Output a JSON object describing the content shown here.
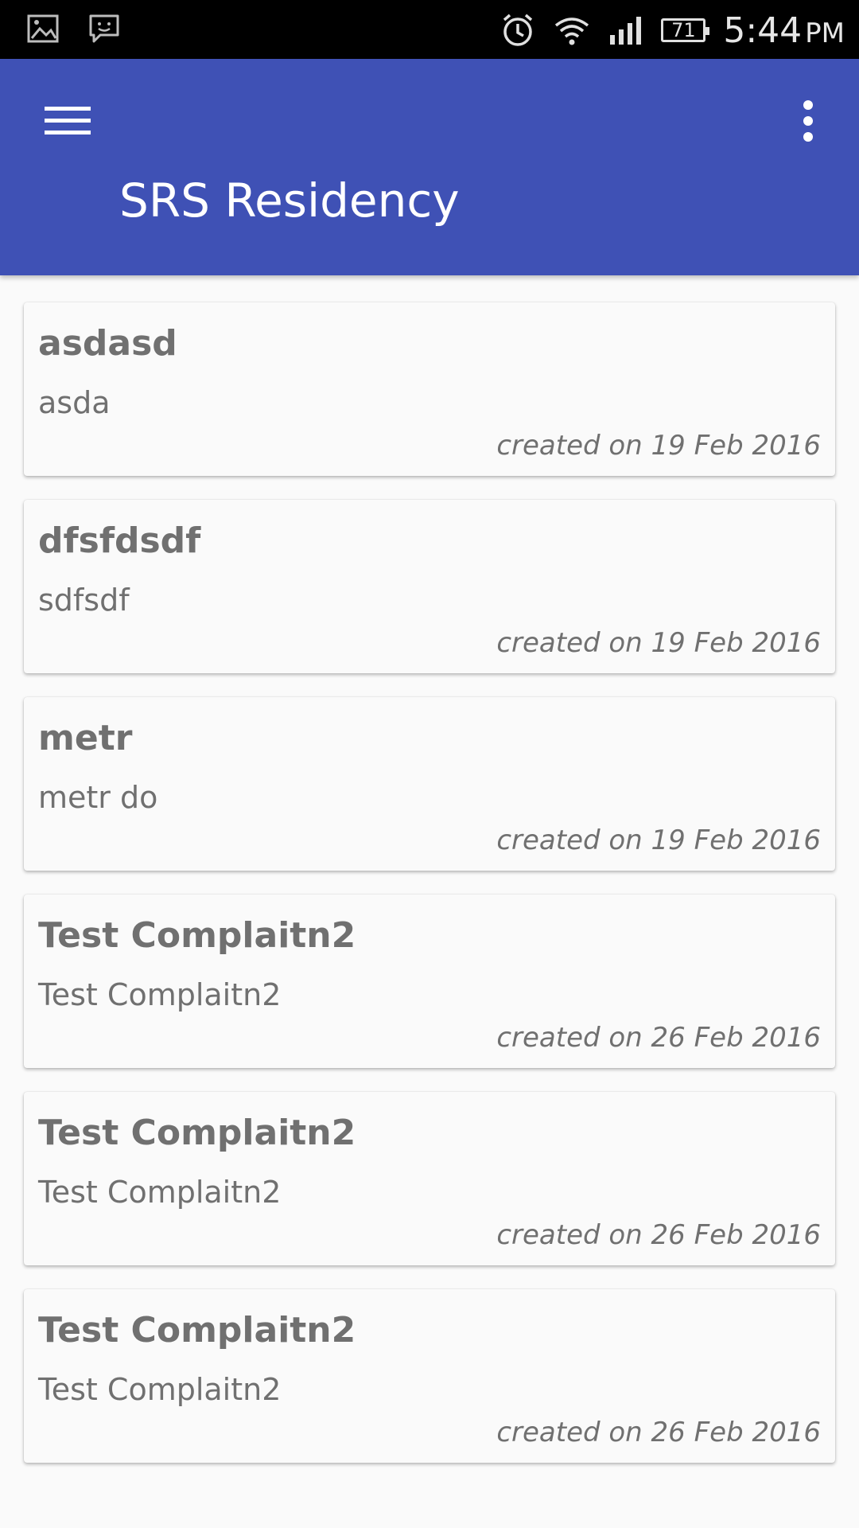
{
  "status_bar": {
    "left_icons": [
      "gallery-icon",
      "chat-icon"
    ],
    "right_icons": [
      "alarm-icon",
      "wifi-icon",
      "signal-icon"
    ],
    "battery_level": "71",
    "time": "5:44",
    "ampm": "PM"
  },
  "app_bar": {
    "title": "SRS Residency",
    "background_color": "#3f51b5",
    "menu_icon": "hamburger-menu-icon",
    "overflow_icon": "more-vertical-icon"
  },
  "complaints": [
    {
      "title": "asdasd",
      "description": "asda",
      "created": "created on 19 Feb 2016"
    },
    {
      "title": "dfsfdsdf",
      "description": "sdfsdf",
      "created": "created on 19 Feb 2016"
    },
    {
      "title": "metr",
      "description": "metr do",
      "created": "created on 19 Feb 2016"
    },
    {
      "title": "Test Complaitn2",
      "description": "Test Complaitn2",
      "created": "created on 26 Feb 2016"
    },
    {
      "title": "Test Complaitn2",
      "description": "Test Complaitn2",
      "created": "created on 26 Feb 2016"
    },
    {
      "title": "Test Complaitn2",
      "description": "Test Complaitn2",
      "created": "created on 26 Feb 2016"
    }
  ]
}
